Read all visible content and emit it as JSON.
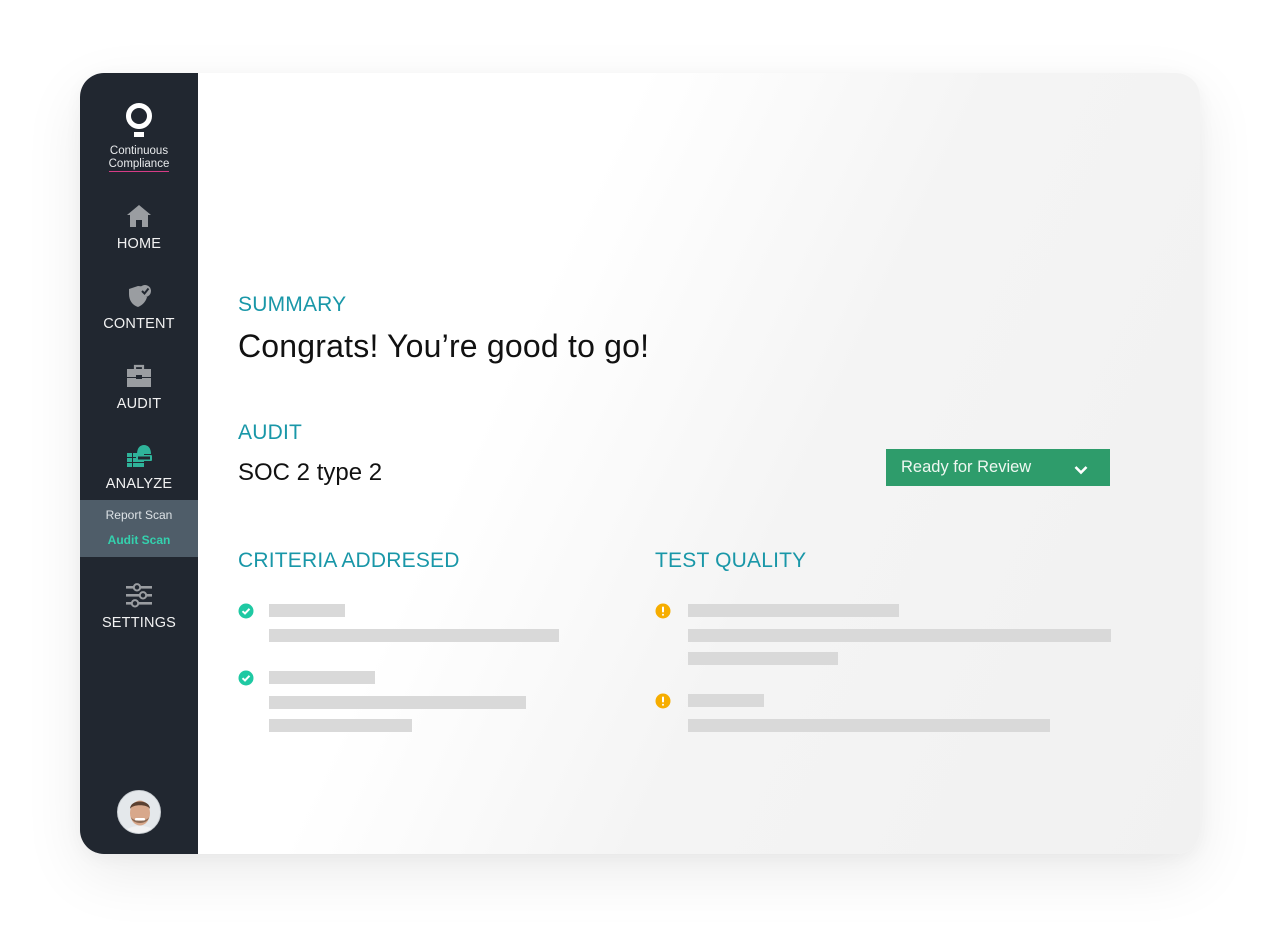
{
  "app": {
    "brand_line1": "Continuous",
    "brand_line2": "Compliance",
    "accent_color": "#1997a8",
    "brand_underline_color": "#d63c86"
  },
  "sidebar": {
    "items": [
      {
        "label": "HOME",
        "icon": "home-icon"
      },
      {
        "label": "CONTENT",
        "icon": "shield-check-icon"
      },
      {
        "label": "AUDIT",
        "icon": "briefcase-icon"
      },
      {
        "label": "ANALYZE",
        "icon": "analyze-icon",
        "active": true
      },
      {
        "label": "SETTINGS",
        "icon": "sliders-icon"
      }
    ],
    "analyze_sub": [
      {
        "label": "Report Scan",
        "active": false
      },
      {
        "label": "Audit Scan",
        "active": true
      }
    ],
    "user_avatar": "user-avatar"
  },
  "main": {
    "summary_label": "SUMMARY",
    "summary_text": "Congrats! You’re good to go!",
    "audit_label": "AUDIT",
    "audit_name": "SOC 2 type 2",
    "status": {
      "label": "Ready for Review",
      "color": "#2e9c6b"
    },
    "criteria": {
      "title": "CRITERIA ADDRESED",
      "status_icon": "check-circle-icon",
      "status_color": "#1fc9a3",
      "items": 2
    },
    "test_quality": {
      "title": "TEST QUALITY",
      "status_icon": "warning-circle-icon",
      "status_color": "#f6ad00",
      "items": 2
    }
  }
}
